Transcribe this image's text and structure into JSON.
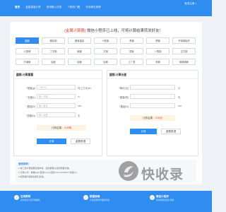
{
  "header": {
    "nav": [
      "首页",
      "金属重量计算",
      "常用管公式表",
      "个税热门看",
      "在线单位换算"
    ],
    "login": "登录注册"
  },
  "notice": {
    "highlight": "(金属计算器)",
    "text": " 微信小程序已上线，可将计算结果转发好友！"
  },
  "materials": [
    "圆钢",
    "螺纹钢",
    "圆管重量",
    "H型钢",
    "角钢",
    "槽钢",
    "不锈钢板材",
    "六角棒",
    "工字钢",
    "扁钢",
    "方钢",
    "铜板",
    "八角钢",
    "正方钢",
    "方钢管",
    "铝板",
    "铝管",
    "铝棒",
    "工厂表",
    "铁棒",
    "铜棒钢管"
  ],
  "left_card": {
    "title": "圆钢-计算重量",
    "rows": [
      {
        "label": "*密度(ρ)",
        "value": "7.85*10",
        "unit": "吨/立方米(t/m"
      },
      {
        "label": "*长度(L)",
        "value": "输入长度",
        "unit": "m"
      },
      {
        "label": "*直径(D)",
        "value": "输入直径",
        "unit": "mm"
      },
      {
        "label": "*支数(N)",
        "value": "输入支数",
        "unit": "支"
      }
    ],
    "result_label": "计算结果：",
    "result_value": "0.00吨",
    "calc_button": "计算",
    "reset_button": "重置数据"
  },
  "right_card": {
    "title": "圆钢-计算长度",
    "rows": [
      {
        "label": "*单价(元)",
        "value": "",
        "unit": "元"
      },
      {
        "label": "*重量(吨)",
        "value": "",
        "unit": "吨"
      },
      {
        "label": "*直径(D)",
        "value": "",
        "unit": "mm"
      }
    ],
    "result_label": "计算结果：",
    "result_value": "0.00元",
    "calc_button": "计算",
    "reset_button": "重置数据"
  },
  "explain": {
    "title": "使用说明：",
    "lines": [
      "1.本工具计算结果仅供参考，实际重量以实际称量为准。",
      "2.计算公式：重量(kg)=直径(mm)×直径(mm)×0.00617×长度(m)",
      "3.如有疑问请联系我们反馈。"
    ]
  },
  "footer": {
    "cols": [
      {
        "icon": "✓",
        "title": "在线帮助",
        "desc": "提供常见计算问题解答"
      },
      {
        "icon": "✓",
        "title": "数据准确",
        "desc": "计算结果参考国家标准"
      },
      {
        "icon": "✓",
        "title": "微信小程序",
        "desc": "随时随地使用计算器"
      }
    ]
  },
  "watermark": {
    "text": "快收录"
  },
  "colors": {
    "primary": "#2f8cf0",
    "accent_red": "#e6402e",
    "result_bg": "#fdf3e3"
  }
}
